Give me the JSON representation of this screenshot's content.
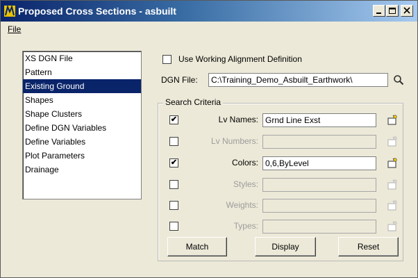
{
  "window": {
    "title": "Proposed Cross Sections - asbuilt",
    "minimize_label": "_",
    "restore_label": "□",
    "close_label": "×"
  },
  "menu": {
    "file": "File"
  },
  "nav_list": {
    "items": [
      "XS DGN File",
      "Pattern",
      "Existing Ground",
      "Shapes",
      "Shape Clusters",
      "Define DGN Variables",
      "Define Variables",
      "Plot Parameters",
      "Drainage"
    ],
    "selected_index": 2
  },
  "use_working_alignment": {
    "label": "Use Working Alignment Definition",
    "checked": false
  },
  "dgn_file": {
    "label": "DGN File:",
    "value": "C:\\Training_Demo_Asbuilt_Earthwork\\"
  },
  "search_criteria": {
    "legend": "Search Criteria",
    "rows": [
      {
        "label": "Lv Names:",
        "checked": true,
        "enabled": true,
        "value": "Grnd Line Exst"
      },
      {
        "label": "Lv Numbers:",
        "checked": false,
        "enabled": false,
        "value": ""
      },
      {
        "label": "Colors:",
        "checked": true,
        "enabled": true,
        "value": "0,6,ByLevel"
      },
      {
        "label": "Styles:",
        "checked": false,
        "enabled": false,
        "value": ""
      },
      {
        "label": "Weights:",
        "checked": false,
        "enabled": false,
        "value": ""
      },
      {
        "label": "Types:",
        "checked": false,
        "enabled": false,
        "value": ""
      }
    ]
  },
  "buttons": {
    "match": "Match",
    "display": "Display",
    "reset": "Reset"
  },
  "icons": {
    "app": "microstation-icon",
    "browse": "magnifier-icon",
    "pick": "pick-element-icon"
  },
  "colors": {
    "title_start": "#0a246a",
    "title_end": "#a6caf0",
    "selection": "#0a246a",
    "dialog_bg": "#ece9d8"
  }
}
